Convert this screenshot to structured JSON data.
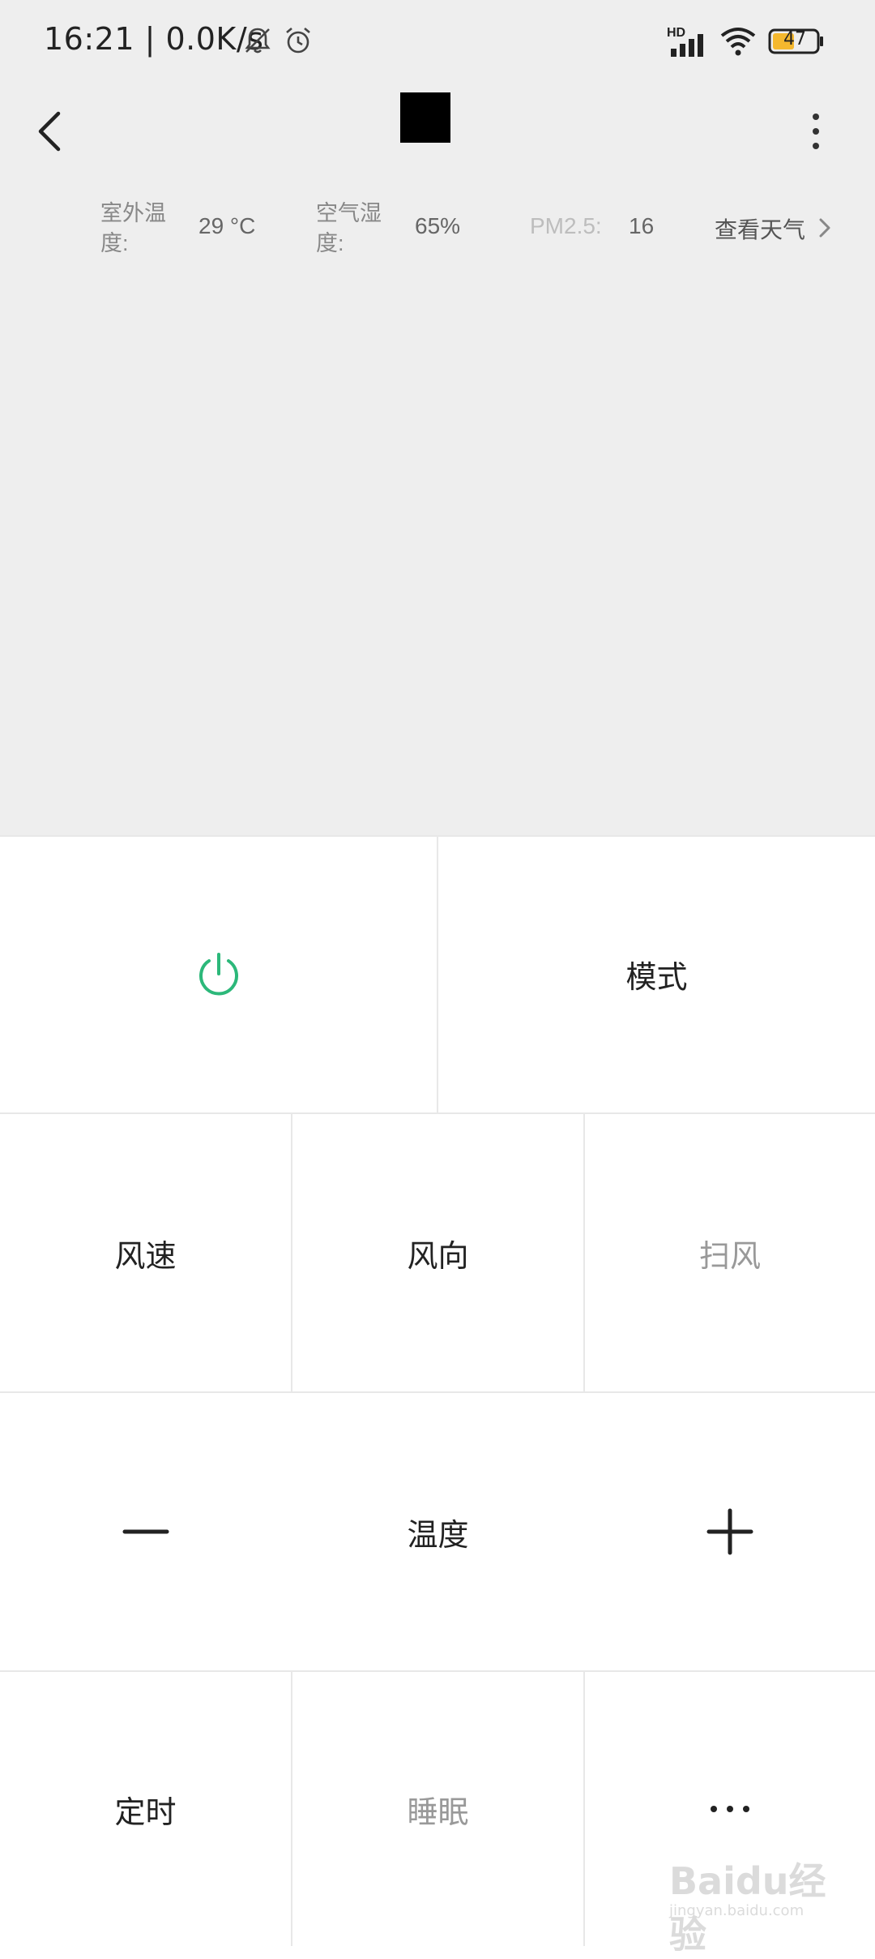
{
  "status_bar": {
    "time_speed": "16:21 | 0.0K/s",
    "network_badge": "HD",
    "battery_level": "47",
    "icons": [
      "bell-off-icon",
      "alarm-icon",
      "signal-icon",
      "wifi-icon",
      "battery-icon"
    ]
  },
  "app_bar": {
    "icons": [
      "back-icon",
      "more-vertical-icon"
    ]
  },
  "weather": {
    "outdoor_temp_label": "室外温度:",
    "outdoor_temp_value": "29 °C",
    "humidity_label": "空气湿度:",
    "humidity_value": "65%",
    "pm25_label": "PM2.5:",
    "pm25_value": "16",
    "view_weather_link": "查看天气"
  },
  "controls": {
    "row1": {
      "power_icon": "power-icon",
      "mode_label": "模式"
    },
    "row2": {
      "fan_speed_label": "风速",
      "fan_direction_label": "风向",
      "swing_label": "扫风"
    },
    "row3": {
      "temperature_label": "温度",
      "decrease_icon": "minus-icon",
      "increase_icon": "plus-icon"
    },
    "row4": {
      "timer_label": "定时",
      "sleep_label": "睡眠",
      "more_icon": "ellipsis-icon"
    }
  },
  "watermark": {
    "main": "Baidu经验",
    "sub": "jingyan.baidu.com"
  },
  "colors": {
    "accent_green": "#2cb87a",
    "top_background": "#eeeeee",
    "divider": "#e8e8e8",
    "dim_text": "#999999"
  }
}
